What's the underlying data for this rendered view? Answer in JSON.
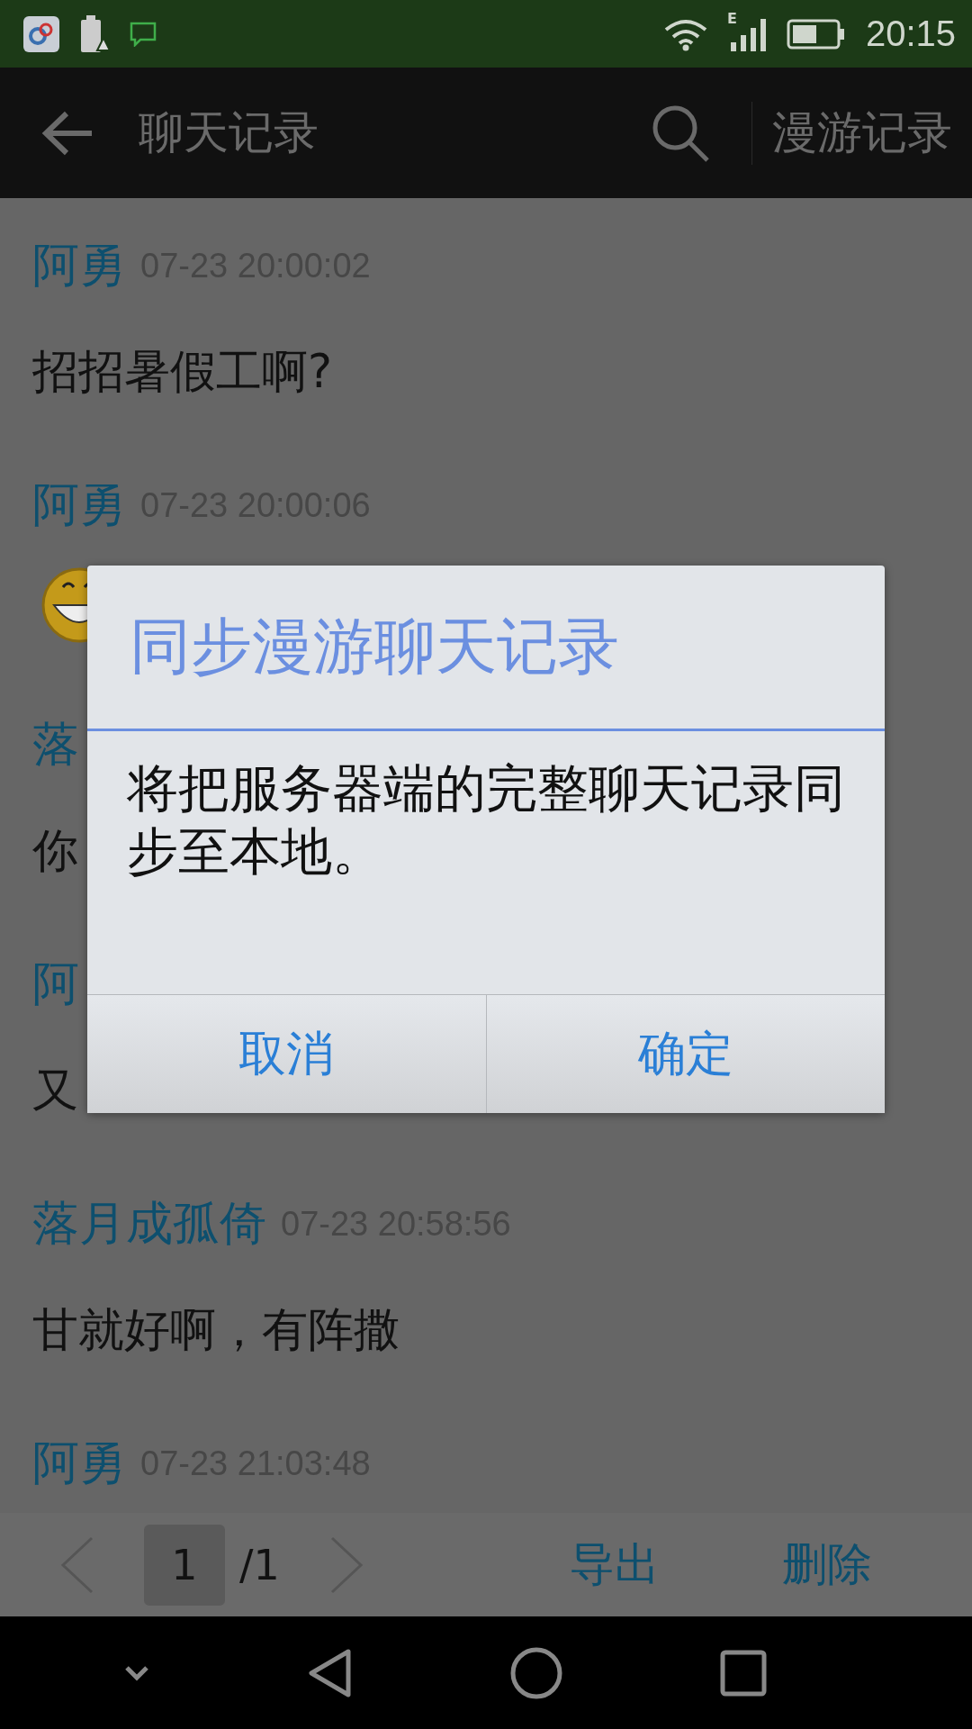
{
  "status_bar": {
    "time": "20:15",
    "network": "E"
  },
  "app_bar": {
    "title": "聊天记录",
    "action": "漫游记录"
  },
  "messages": [
    {
      "name": "阿勇",
      "time": "07-23  20:00:02",
      "kind": "text",
      "text": "招招暑假工啊?"
    },
    {
      "name": "阿勇",
      "time": "07-23  20:00:06",
      "kind": "emoji"
    },
    {
      "name": "落",
      "kind": "text",
      "text": "你"
    },
    {
      "name": "阿",
      "kind": "text",
      "text": "又"
    },
    {
      "name": "落月成孤倚",
      "time": "07-23  20:58:56",
      "kind": "text",
      "text": "甘就好啊，有阵撒"
    },
    {
      "name": "阿勇",
      "time": "07-23  21:03:48",
      "kind": "none"
    }
  ],
  "pager": {
    "page": "1",
    "total": "/1",
    "actions": [
      "导出",
      "删除"
    ]
  },
  "dialog": {
    "title": "同步漫游聊天记录",
    "message": "将把服务器端的完整聊天记录同步至本地。",
    "buttons": [
      "取消",
      "确定"
    ]
  }
}
